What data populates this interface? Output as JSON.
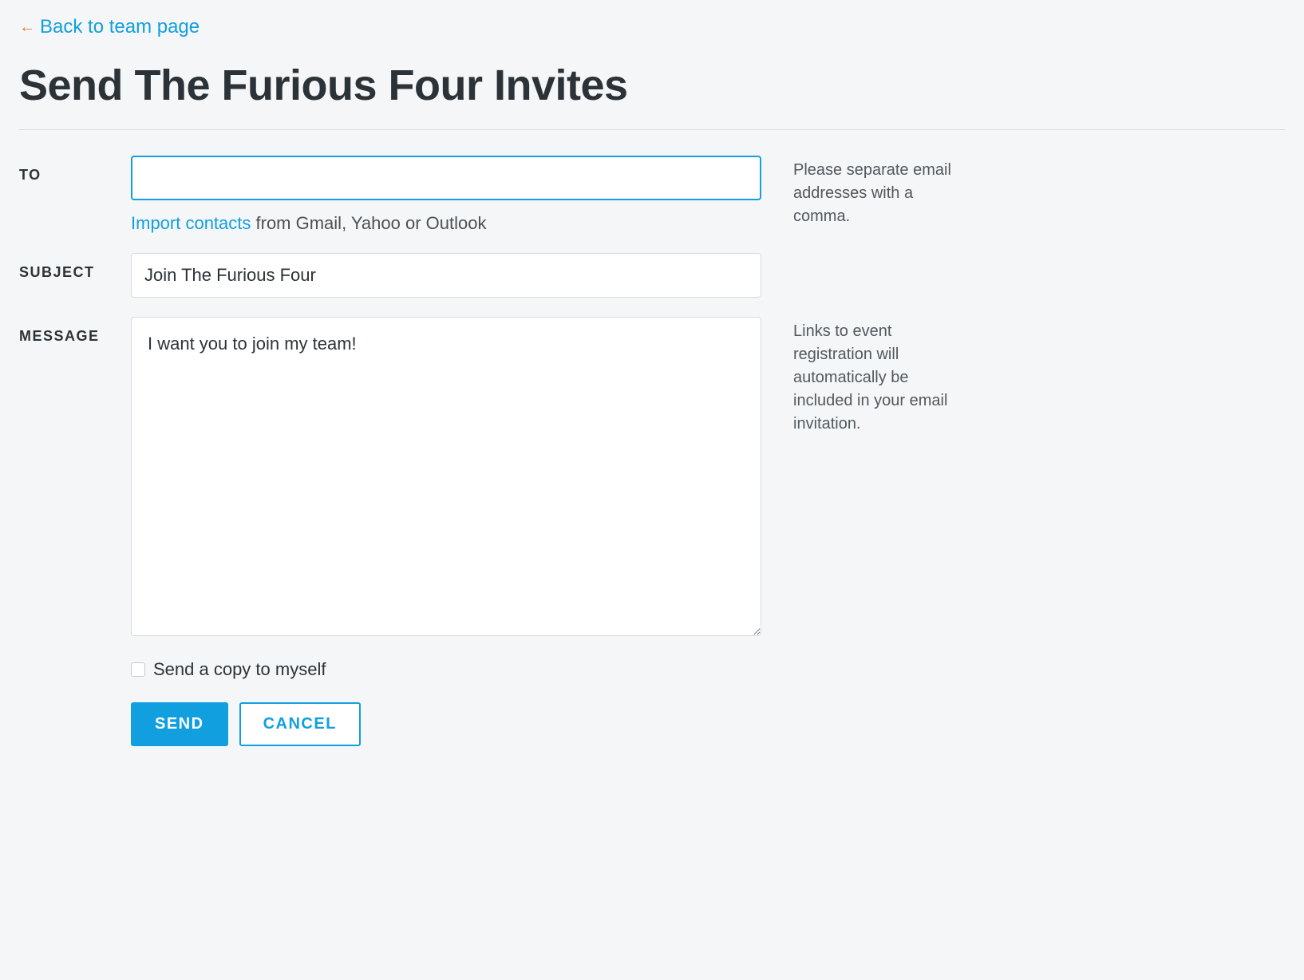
{
  "back_link": {
    "arrow": "←",
    "label": "Back to team page"
  },
  "page_title": "Send The Furious Four Invites",
  "form": {
    "to": {
      "label": "TO",
      "value": "",
      "help": "Please separate email addresses with a comma."
    },
    "import": {
      "link_text": "Import contacts",
      "rest_text": " from Gmail, Yahoo or Outlook"
    },
    "subject": {
      "label": "SUBJECT",
      "value": "Join The Furious Four"
    },
    "message": {
      "label": "MESSAGE",
      "value": "I want you to join my team!",
      "help": "Links to event registration will automatically be included in your email invitation."
    },
    "copy_self": {
      "label": "Send a copy to myself"
    },
    "buttons": {
      "send": "SEND",
      "cancel": "CANCEL"
    }
  }
}
